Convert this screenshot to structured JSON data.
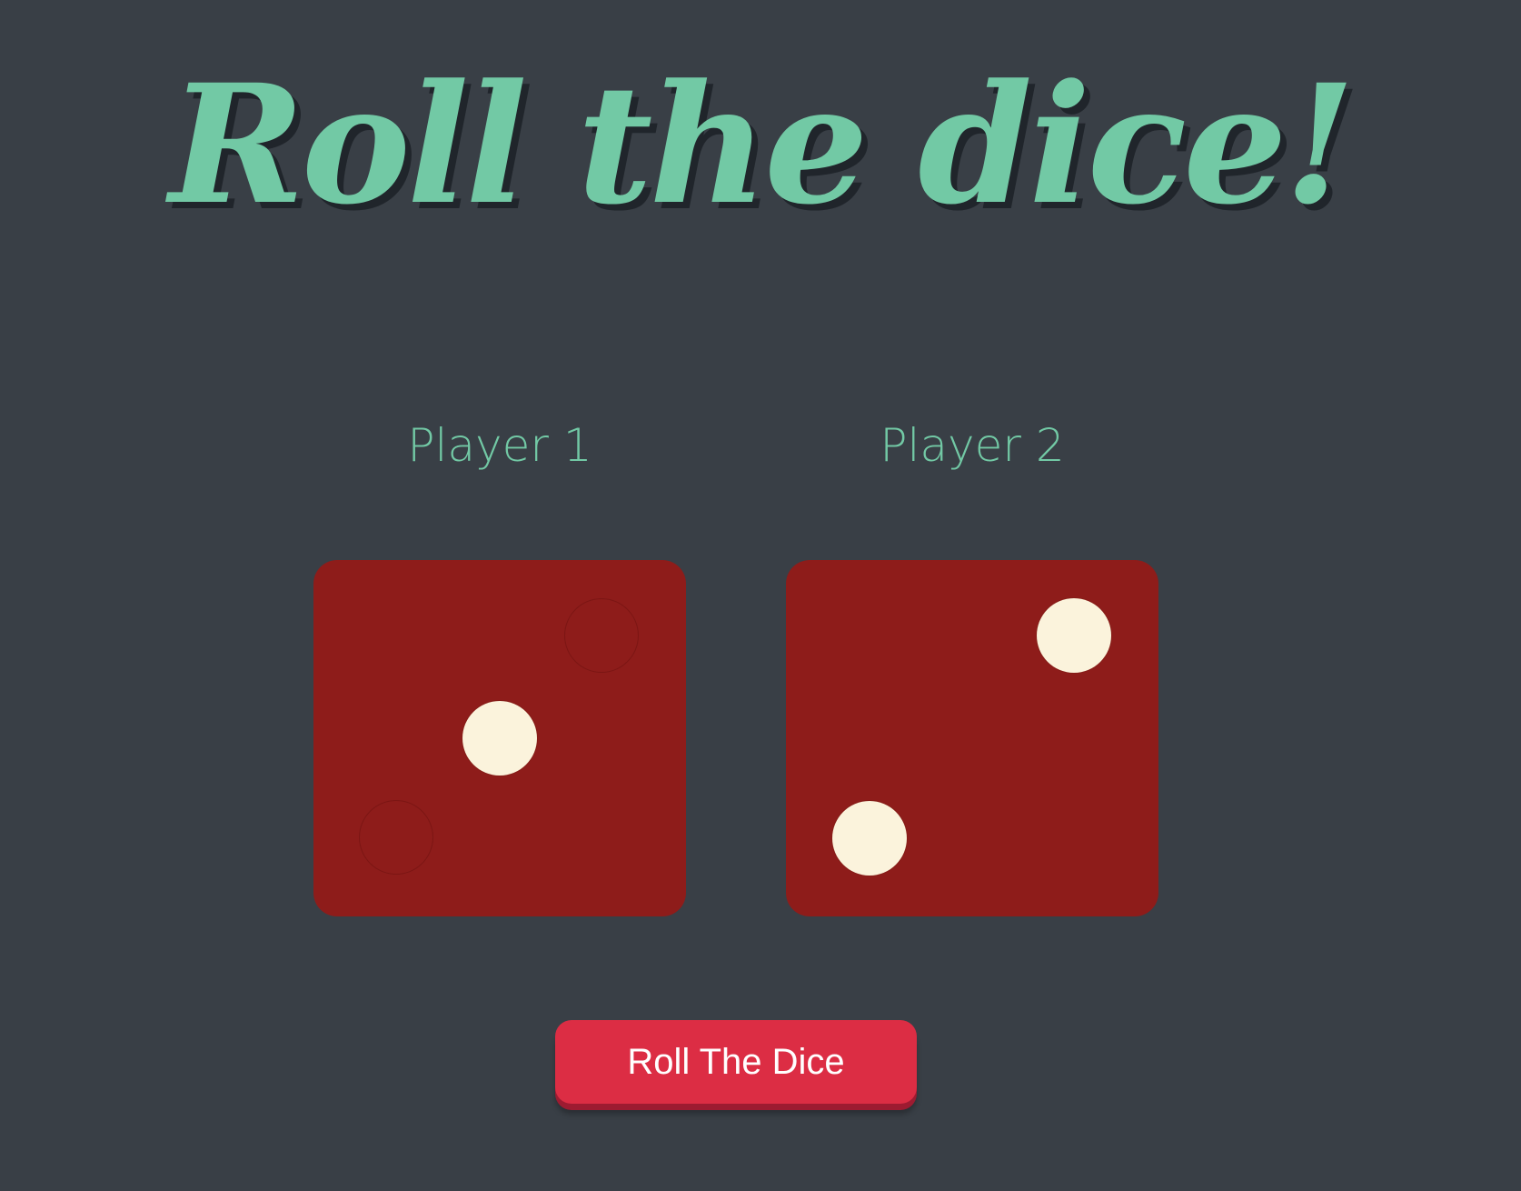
{
  "title": "Roll the dice!",
  "players": [
    {
      "label": "Player 1",
      "die_value": 1
    },
    {
      "label": "Player 2",
      "die_value": 2
    }
  ],
  "roll_button": {
    "label": "Roll The Dice"
  },
  "colors": {
    "background": "#393f46",
    "accent_green": "#72c9a5",
    "die_red": "#8e1c1a",
    "pip_cream": "#fbf3dc",
    "button_red": "#dc2d44"
  }
}
